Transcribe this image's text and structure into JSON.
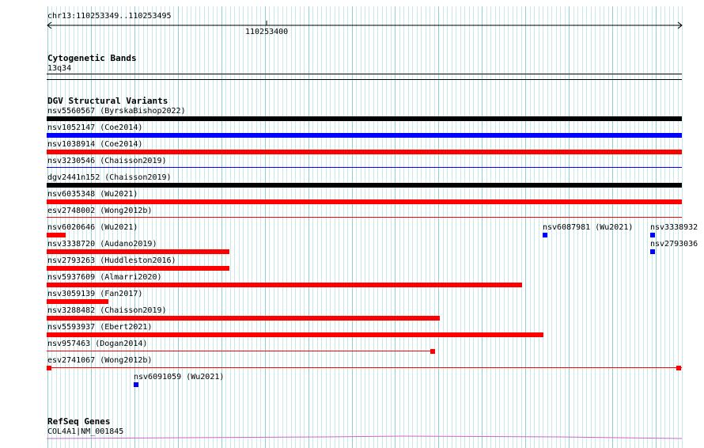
{
  "header": {
    "locus": "chr13:110253349..110253495",
    "tick_label": "110253400"
  },
  "cytoband": {
    "title": "Cytogenetic Bands",
    "band": "13q34"
  },
  "dgv": {
    "title": "DGV Structural Variants",
    "variants": [
      {
        "label": "nsv5560567 (ByrskaBishop2022)",
        "color": "#000000",
        "style": "thick"
      },
      {
        "label": "nsv1052147 (Coe2014)",
        "color": "#0000ff",
        "style": "thick"
      },
      {
        "label": "nsv1038914 (Coe2014)",
        "color": "#ff0000",
        "style": "thick"
      },
      {
        "label": "nsv3230546 (Chaisson2019)",
        "color": "#0000ff",
        "style": "thin"
      },
      {
        "label": "dgv2441n152 (Chaisson2019)",
        "color": "#000000",
        "style": "thick"
      },
      {
        "label": "nsv6035348 (Wu2021)",
        "color": "#ff0000",
        "style": "thick"
      },
      {
        "label": "esv2748002 (Wong2012b)",
        "color": "#ff0000",
        "style": "thin"
      },
      {
        "label": "nsv6020646 (Wu2021)",
        "color": "#ff0000",
        "style": "thick"
      },
      {
        "label": "nsv6087981 (Wu2021)",
        "color": "#0000ff",
        "style": "dot"
      },
      {
        "label": "nsv3338932",
        "color": "#0000ff",
        "style": "dot"
      },
      {
        "label": "nsv3338720 (Audano2019)",
        "color": "#ff0000",
        "style": "thick"
      },
      {
        "label": "nsv2793036",
        "color": "#0000ff",
        "style": "dot"
      },
      {
        "label": "nsv2793263 (Huddleston2016)",
        "color": "#ff0000",
        "style": "thick"
      },
      {
        "label": "nsv5937609 (Almarri2020)",
        "color": "#ff0000",
        "style": "thick"
      },
      {
        "label": "nsv3059139 (Fan2017)",
        "color": "#ff0000",
        "style": "thick"
      },
      {
        "label": "nsv3288482 (Chaisson2019)",
        "color": "#ff0000",
        "style": "thick"
      },
      {
        "label": "nsv5593937 (Ebert2021)",
        "color": "#ff0000",
        "style": "thick"
      },
      {
        "label": "nsv957463 (Dogan2014)",
        "color": "#ff0000",
        "style": "line-end"
      },
      {
        "label": "esv2741067 (Wong2012b)",
        "color": "#ff0000",
        "style": "line-both"
      },
      {
        "label": "nsv6091059 (Wu2021)",
        "color": "#0000ff",
        "style": "dot"
      }
    ]
  },
  "refseq": {
    "title": "RefSeq Genes",
    "gene": "COL4A1|NM_001845",
    "color": "#cc66cc"
  }
}
